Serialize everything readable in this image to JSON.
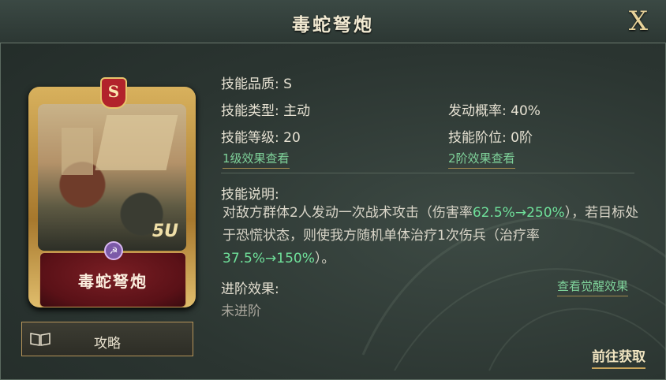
{
  "header": {
    "title": "毒蛇弩炮",
    "close_label": "X"
  },
  "card": {
    "rank": "S",
    "name": "毒蛇弩炮",
    "level_mark": "5U",
    "faction_icon": "faction-emblem-icon"
  },
  "guide_button": {
    "label": "攻略",
    "icon": "book-icon"
  },
  "info": {
    "quality": "技能品质: S",
    "type": "技能类型: 主动",
    "trigger_rate": "发动概率: 40%",
    "level": "技能等级: 20",
    "tier": "技能阶位: 0阶",
    "level1_link": "1级效果查看",
    "tier2_link": "2阶效果查看"
  },
  "description": {
    "title": "技能说明:",
    "part1": "对敌方群体2人发动一次战术攻击（伤害率",
    "hl1": "62.5%→250%",
    "part2": "），若目标处于恐慌状态，则使我方随机单体治疗1次伤兵（治疗率",
    "hl2": "37.5%→150%",
    "part3": "）。"
  },
  "advance": {
    "title": "进阶效果:",
    "value": "未进阶",
    "awaken_link": "查看觉醒效果"
  },
  "footer": {
    "goto_label": "前往获取"
  },
  "colors": {
    "highlight": "#6fe09a",
    "link": "#7fd29a",
    "gold": "#c9a55c"
  }
}
